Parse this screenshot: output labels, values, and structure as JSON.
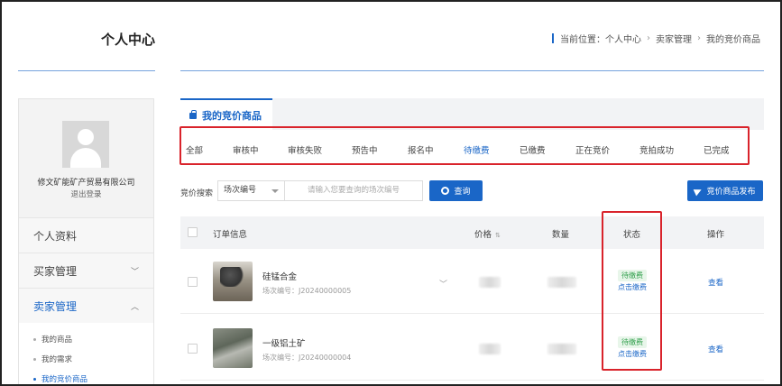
{
  "header": {
    "title": "个人中心",
    "breadcrumb": {
      "prefix": "当前位置：",
      "items": [
        "个人中心",
        "卖家管理",
        "我的竞价商品"
      ],
      "separator": "›"
    }
  },
  "sidebar": {
    "company": "修文矿能矿产贸易有限公司",
    "logout": "退出登录",
    "menu": [
      {
        "label": "个人资料",
        "chevron": ""
      },
      {
        "label": "买家管理",
        "chevron": "﹀"
      },
      {
        "label": "卖家管理",
        "chevron": "︿"
      }
    ],
    "submenu": [
      "我的商品",
      "我的需求",
      "我的竞价商品"
    ]
  },
  "main": {
    "active_tab": "我的竞价商品",
    "status_tabs": [
      "全部",
      "审核中",
      "审核失败",
      "预告中",
      "报名中",
      "待缴费",
      "已缴费",
      "正在竞价",
      "竞拍成功",
      "已完成"
    ],
    "active_status": "待缴费",
    "search": {
      "label": "竞价搜索",
      "select_value": "场次编号",
      "placeholder": "请输入您要查询的场次编号",
      "button": "查询"
    },
    "publish_button": "竞价商品发布",
    "table": {
      "headers": {
        "order": "订单信息",
        "price": "价格",
        "price_sort": "⇅",
        "quantity": "数量",
        "status": "状态",
        "action": "操作"
      },
      "rows": [
        {
          "name": "硅锰合金",
          "code": "场次编号：J20240000005",
          "status": "待缴费",
          "pay": "点击缴费",
          "action": "查看"
        },
        {
          "name": "一级铝土矿",
          "code": "场次编号：J20240000004",
          "status": "待缴费",
          "pay": "点击缴费",
          "action": "查看"
        }
      ]
    }
  },
  "colors": {
    "accent": "#1a66c7",
    "highlight": "#d9232b",
    "status_green": "#2e9e4a"
  }
}
